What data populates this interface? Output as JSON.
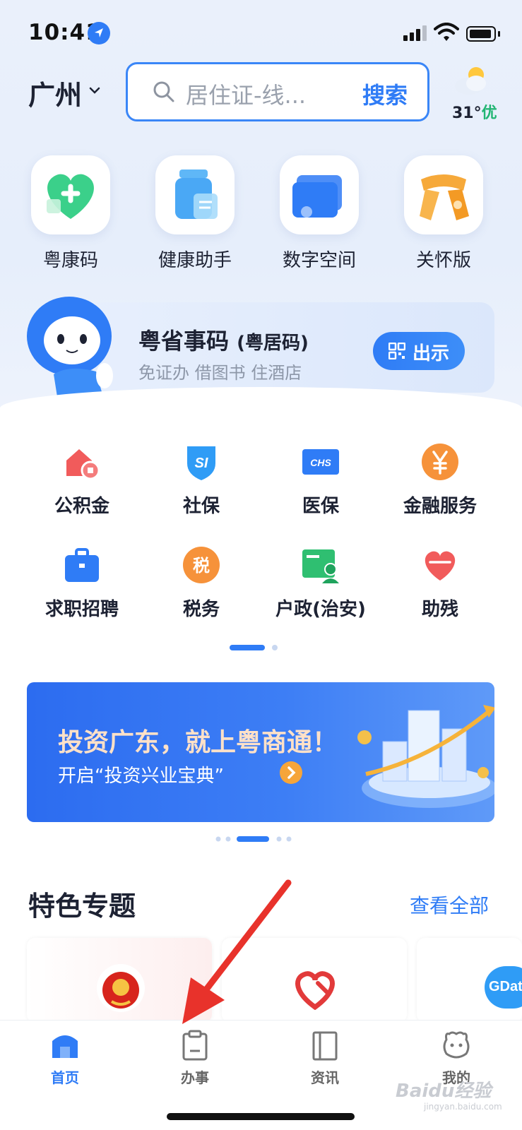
{
  "status_bar": {
    "time": "10:41"
  },
  "header": {
    "city": "广州",
    "search_placeholder": "居住证-线...",
    "search_button": "搜索",
    "weather_temp": "31°",
    "weather_air": "优"
  },
  "quick_actions": [
    {
      "label": "粤康码",
      "icon": "green-heart-icon"
    },
    {
      "label": "健康助手",
      "icon": "bottle-icon"
    },
    {
      "label": "数字空间",
      "icon": "wallet-icon"
    },
    {
      "label": "关怀版",
      "icon": "scarf-icon"
    }
  ],
  "code_card": {
    "title": "粤省事码",
    "title_suffix": "(粤居码)",
    "subtitle": "免证办 借图书 住酒店",
    "show_button": "出示"
  },
  "services": [
    {
      "label": "公积金",
      "icon": "housing-fund-icon"
    },
    {
      "label": "社保",
      "icon": "social-security-icon"
    },
    {
      "label": "医保",
      "icon": "medical-insurance-icon"
    },
    {
      "label": "金融服务",
      "icon": "yuan-icon"
    },
    {
      "label": "求职招聘",
      "icon": "briefcase-icon"
    },
    {
      "label": "税务",
      "icon": "tax-icon"
    },
    {
      "label": "户政(治安)",
      "icon": "household-icon"
    },
    {
      "label": "助残",
      "icon": "heart-icon"
    }
  ],
  "banner": {
    "title": "投资广东，就上粤商通！",
    "subtitle": "开启“投资兴业宝典”"
  },
  "featured": {
    "title": "特色专题",
    "view_all": "查看全部",
    "card3_text": "GDat"
  },
  "tabbar": [
    {
      "label": "首页",
      "active": true
    },
    {
      "label": "办事",
      "active": false
    },
    {
      "label": "资讯",
      "active": false
    },
    {
      "label": "我的",
      "active": false
    }
  ],
  "watermark": {
    "text": "Baidu经验",
    "url_text": "jingyan.baidu.com"
  },
  "colors": {
    "accent": "#2f7cf6",
    "air_good": "#22b573",
    "arrow": "#e8322b"
  }
}
